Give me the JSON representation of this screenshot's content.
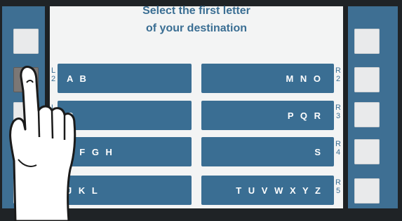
{
  "screen": {
    "title_line1": "Select the first letter",
    "title_line2": "of your destination"
  },
  "left_options": [
    {
      "label": "A B",
      "tag_letter": "L",
      "tag_number": "2"
    },
    {
      "label": "C",
      "tag_letter": "L",
      "tag_number": "3"
    },
    {
      "label": "E F G H",
      "tag_letter": "L",
      "tag_number": "4"
    },
    {
      "label": "J K L",
      "tag_letter": "L",
      "tag_number": "5"
    }
  ],
  "right_options": [
    {
      "label": "M N O",
      "tag_letter": "R",
      "tag_number": "2"
    },
    {
      "label": "P Q R",
      "tag_letter": "R",
      "tag_number": "3"
    },
    {
      "label": "S",
      "tag_letter": "R",
      "tag_number": "4"
    },
    {
      "label": "T U V W X Y Z",
      "tag_letter": "R",
      "tag_number": "5"
    }
  ],
  "colors": {
    "accent": "#3a6e93",
    "screen_bg": "#f3f4f4",
    "pressed_key": "#7b7775"
  },
  "icons": {
    "pointer": "hand-pointer-icon"
  }
}
